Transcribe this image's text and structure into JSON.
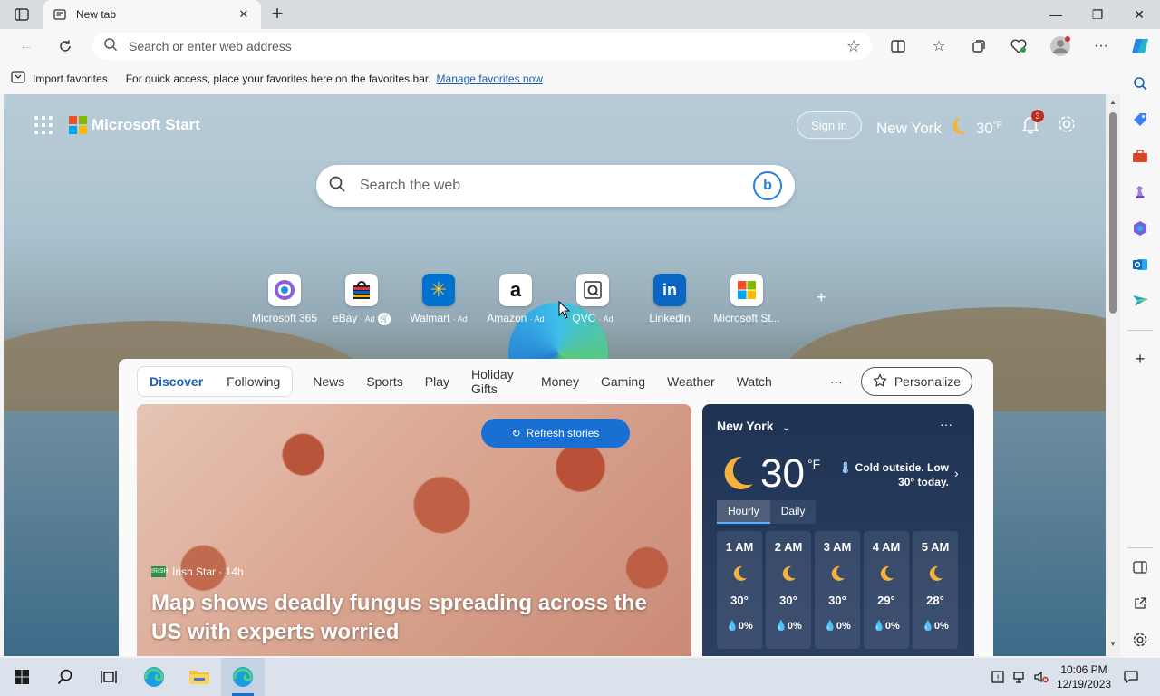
{
  "browser": {
    "tab_title": "New tab",
    "address_placeholder": "Search or enter web address"
  },
  "favorites_bar": {
    "import_label": "Import favorites",
    "message": "For quick access, place your favorites here on the favorites bar.",
    "manage_link": "Manage favorites now"
  },
  "page": {
    "brand": "Microsoft Start",
    "signin": "Sign in",
    "weather_city": "New York",
    "weather_temp": "30",
    "weather_unit": "°F",
    "notif_count": "3",
    "search_placeholder": "Search the web",
    "add_tile": "+"
  },
  "tiles": [
    {
      "label": "Microsoft 365",
      "ad": ""
    },
    {
      "label": "eBay",
      "ad": "· Ad"
    },
    {
      "label": "Walmart",
      "ad": "· Ad"
    },
    {
      "label": "Amazon",
      "ad": "· Ad"
    },
    {
      "label": "QVC",
      "ad": "· Ad"
    },
    {
      "label": "LinkedIn",
      "ad": ""
    },
    {
      "label": "Microsoft St...",
      "ad": ""
    }
  ],
  "feed": {
    "tabs": [
      "Discover",
      "Following"
    ],
    "links": [
      "News",
      "Sports",
      "Play",
      "Holiday Gifts",
      "Money",
      "Gaming",
      "Weather",
      "Watch"
    ],
    "more": "···",
    "personalize": "Personalize",
    "refresh": "Refresh stories",
    "source": "Irish Star · 14h",
    "source_logo": "IRISH",
    "headline": "Map shows deadly fungus spreading across the US with experts worried"
  },
  "weather_card": {
    "city": "New York",
    "more": "···",
    "temp": "30",
    "unit": "°F",
    "note": "Cold outside. Low 30° today.",
    "tab_hourly": "Hourly",
    "tab_daily": "Daily",
    "hours": [
      {
        "time": "1 AM",
        "temp": "30°",
        "precip": "0%"
      },
      {
        "time": "2 AM",
        "temp": "30°",
        "precip": "0%"
      },
      {
        "time": "3 AM",
        "temp": "30°",
        "precip": "0%"
      },
      {
        "time": "4 AM",
        "temp": "29°",
        "precip": "0%"
      },
      {
        "time": "5 AM",
        "temp": "28°",
        "precip": "0%"
      }
    ]
  },
  "taskbar": {
    "time": "10:06 PM",
    "date": "12/19/2023"
  },
  "colors": {
    "accent": "#1a6fd2",
    "weather_bg": "#1f3354"
  }
}
